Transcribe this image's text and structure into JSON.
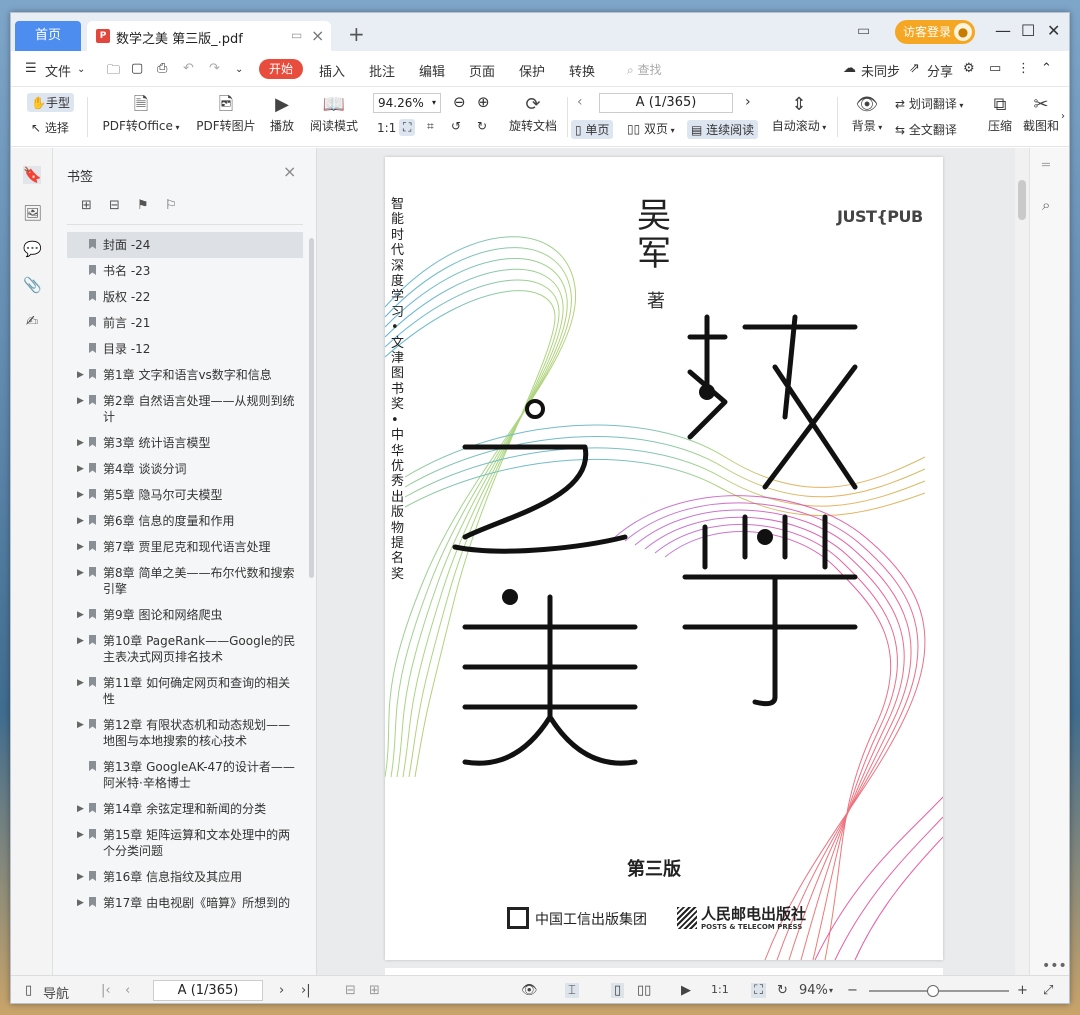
{
  "titlebar": {
    "home_tab": "首页",
    "doc_tab": "数学之美 第三版_.pdf",
    "guest_login": "访客登录"
  },
  "menubar": {
    "file": "文件",
    "items": [
      "开始",
      "插入",
      "批注",
      "编辑",
      "页面",
      "保护",
      "转换"
    ],
    "search": "查找",
    "sync": "未同步",
    "share": "分享"
  },
  "ribbon": {
    "hand": "手型",
    "select": "选择",
    "pdf_to_office": "PDF转Office",
    "pdf_to_image": "PDF转图片",
    "play": "播放",
    "read_mode": "阅读模式",
    "zoom": "94.26%",
    "rotate_doc": "旋转文档",
    "page_indicator": "A (1/365)",
    "single_page": "单页",
    "double_page": "双页",
    "continuous": "连续阅读",
    "auto_scroll": "自动滚动",
    "background": "背景",
    "word_translate": "划词翻译",
    "full_translate": "全文翻译",
    "compress": "压缩",
    "screenshot": "截图和"
  },
  "bookmarks": {
    "title": "书签",
    "items": [
      {
        "label": "封面 -24",
        "expandable": false
      },
      {
        "label": "书名 -23",
        "expandable": false
      },
      {
        "label": "版权 -22",
        "expandable": false
      },
      {
        "label": "前言 -21",
        "expandable": false
      },
      {
        "label": "目录 -12",
        "expandable": false
      },
      {
        "label": "第1章 文字和语言vs数字和信息",
        "expandable": true
      },
      {
        "label": "第2章 自然语言处理——从规则到统计",
        "expandable": true
      },
      {
        "label": "第3章 统计语言模型",
        "expandable": true
      },
      {
        "label": "第4章 谈谈分词",
        "expandable": true
      },
      {
        "label": "第5章 隐马尔可夫模型",
        "expandable": true
      },
      {
        "label": "第6章 信息的度量和作用",
        "expandable": true
      },
      {
        "label": "第7章 贾里尼克和现代语言处理",
        "expandable": true
      },
      {
        "label": "第8章 简单之美——布尔代数和搜索引擎",
        "expandable": true
      },
      {
        "label": "第9章 图论和网络爬虫",
        "expandable": true
      },
      {
        "label": "第10章 PageRank——Google的民主表决式网页排名技术",
        "expandable": true
      },
      {
        "label": "第11章 如何确定网页和查询的相关性",
        "expandable": true
      },
      {
        "label": "第12章 有限状态机和动态规划——地图与本地搜索的核心技术",
        "expandable": true
      },
      {
        "label": "第13章 GoogleAK-47的设计者——阿米特·辛格博士",
        "expandable": false
      },
      {
        "label": "第14章 余弦定理和新闻的分类",
        "expandable": true
      },
      {
        "label": "第15章 矩阵运算和文本处理中的两个分类问题",
        "expandable": true
      },
      {
        "label": "第16章 信息指纹及其应用",
        "expandable": true
      },
      {
        "label": "第17章 由电视剧《暗算》所想到的",
        "expandable": true
      }
    ]
  },
  "cover": {
    "author": "吴军",
    "author_role": "著",
    "tagline": "智能时代 深度学习 • 文津图书奖 • 中华优秀出版物提名奖",
    "imprint": "JUST{PUB",
    "title_chars": [
      "数",
      "学",
      "之",
      "美"
    ],
    "edition": "第三版",
    "publisher_group": "中国工信出版集团",
    "publisher": "人民邮电出版社",
    "publisher_en": "POSTS & TELECOM PRESS"
  },
  "statusbar": {
    "nav": "导航",
    "page": "A (1/365)",
    "zoom": "94%"
  }
}
